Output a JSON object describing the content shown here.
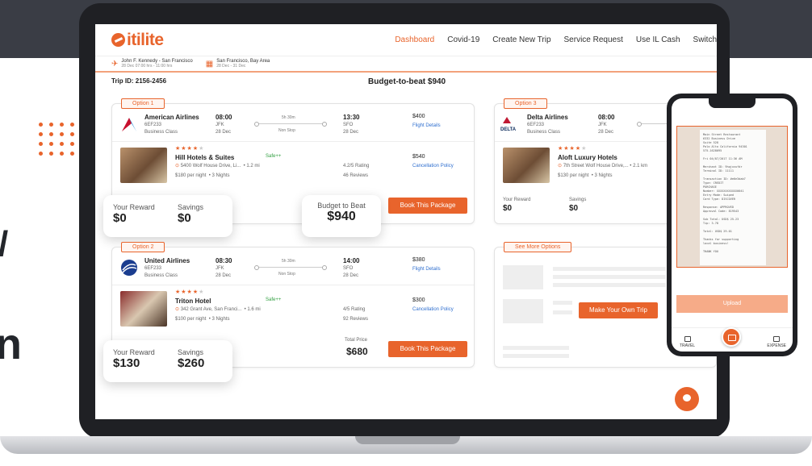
{
  "brand": {
    "name": "itilite",
    "accent": "#e8642c"
  },
  "nav": {
    "links": [
      "Dashboard",
      "Covid-19",
      "Create New Trip",
      "Service Request",
      "Use IL Cash",
      "Switch"
    ],
    "active": "Dashboard"
  },
  "subnav": {
    "flight": {
      "title": "John F. Kennedy - San Francisco",
      "sub": "28 Dec 07:00 hrs - 11:00 hrs"
    },
    "hotel": {
      "title": "San Francisco, Bay Area",
      "sub": "28 Dec - 31 Dec"
    }
  },
  "trip": {
    "id_label": "Trip ID: 2156-2456",
    "budget_title": "Budget-to-beat $940"
  },
  "options": [
    {
      "tag": "Option 1",
      "airline": "American Airlines",
      "flight_no": "6EF233",
      "cabin": "Business Class",
      "dep_time": "08:00",
      "dep_airport": "JFK",
      "dep_date": "28 Dec",
      "duration": "5h 30m",
      "stops": "Non Stop",
      "arr_time": "13:30",
      "arr_airport": "SFO",
      "arr_date": "28 Dec",
      "flight_price": "$400",
      "flight_link": "Flight Details",
      "hotel": "Hill Hotels & Suites",
      "safe": "Safe++",
      "address": "5400 Wolf House Drive, Li...",
      "distance": "1.2 mi",
      "per_night": "$180 per night",
      "nights": "3 Nights",
      "rating": "4.2/5 Rating",
      "reviews": "46 Reviews",
      "hotel_price": "$540",
      "hotel_link": "Cancellation Policy",
      "reward_label": "Your Reward",
      "reward": "$0",
      "savings_label": "Savings",
      "savings": "$0",
      "total_label": "Budget to Beat",
      "total": "$940",
      "book": "Book This Package"
    },
    {
      "tag": "Option 2",
      "airline": "United Airlines",
      "flight_no": "6EF233",
      "cabin": "Business Class",
      "dep_time": "08:30",
      "dep_airport": "JFK",
      "dep_date": "28 Dec",
      "duration": "5h 30m",
      "stops": "Non Stop",
      "arr_time": "14:00",
      "arr_airport": "SFO",
      "arr_date": "28 Dec",
      "flight_price": "$380",
      "flight_link": "Flight Details",
      "hotel": "Triton Hotel",
      "safe": "Safe++",
      "address": "342 Grant Ave, San Franci...",
      "distance": "1.6 mi",
      "per_night": "$100 per night",
      "nights": "3 Nights",
      "rating": "4/5 Rating",
      "reviews": "92 Reviews",
      "hotel_price": "$300",
      "hotel_link": "Cancellation Policy",
      "reward_label": "Your Reward",
      "reward": "$130",
      "savings_label": "Savings",
      "savings": "$260",
      "total_label": "Total Price",
      "total": "$680",
      "book": "Book This Package"
    },
    {
      "tag": "Option 3",
      "airline": "Delta Airlines",
      "flight_no": "6EF233",
      "cabin": "Business Class",
      "dep_time": "08:00",
      "dep_airport": "JFK",
      "dep_date": "28 Dec",
      "hotel": "Aloft Luxury Hotels",
      "address": "7th Street Wolf House Drive,...",
      "distance": "2.1 km",
      "per_night": "$130 per night",
      "nights": "3 Nights",
      "reward_label": "Your Reward",
      "reward": "$0",
      "savings_label": "Savings",
      "savings": "$0"
    }
  ],
  "more": {
    "tag": "See More Options",
    "button": "Make Your Own Trip"
  },
  "phone": {
    "receipt_lines": [
      "Main Street Restaurant",
      "6332 Business Drive",
      "Suite 528",
      "Palo Alto California 94301",
      "575-1628095",
      "",
      "Fri 04/07/2017 11:36 AM",
      "",
      "Merchant ID: 9hqjxvufdr",
      "Terminal ID: 11111",
      "",
      "Transaction ID: #e6e3dab7",
      "Type: CREDIT",
      "PURCHASE",
      "Number: XXXXXXXXXXXX0041",
      "Entry Mode: Swiped",
      "Card Type: DISCOVER",
      "",
      "Response: APPROVED",
      "Approval Code: 819543",
      "",
      "Sub Total: USD$ 25.23",
      "Tip: 3.78",
      "",
      "Total: USD$ 29.01",
      "",
      "Thanks for supporting",
      "local business!",
      "",
      "THANK YOU"
    ],
    "upload": "Upload",
    "tab_left": "TRAVEL",
    "tab_right": "EXPENSE"
  }
}
